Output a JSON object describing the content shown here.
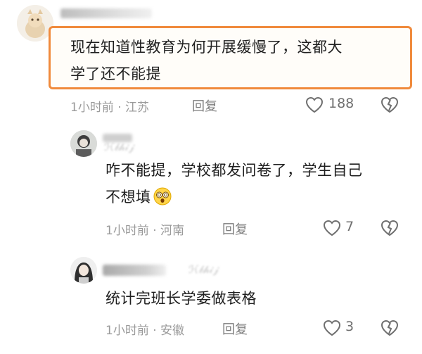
{
  "comments": [
    {
      "text_line1": "现在知道性教育为何开展缓慢了，这都大",
      "text_line2": "学了还不能提",
      "time": "1小时前",
      "location": "江苏",
      "reply_label": "回复",
      "likes": "188"
    },
    {
      "text_line1": "咋不能提，学校都发问卷了，学生自己",
      "text_line2": "不想填",
      "time": "1小时前",
      "location": "河南",
      "reply_label": "回复",
      "likes": "7"
    },
    {
      "text_line1": "统计完班长学委做表格",
      "time": "1小时前",
      "location": "安徽",
      "reply_label": "回复",
      "likes": "3"
    }
  ],
  "colors": {
    "highlight_border": "#f08a3c",
    "meta_text": "#9a9a9a"
  },
  "icons": [
    "heart-icon",
    "dislike-heart-icon",
    "dizzy-face-emoji"
  ]
}
